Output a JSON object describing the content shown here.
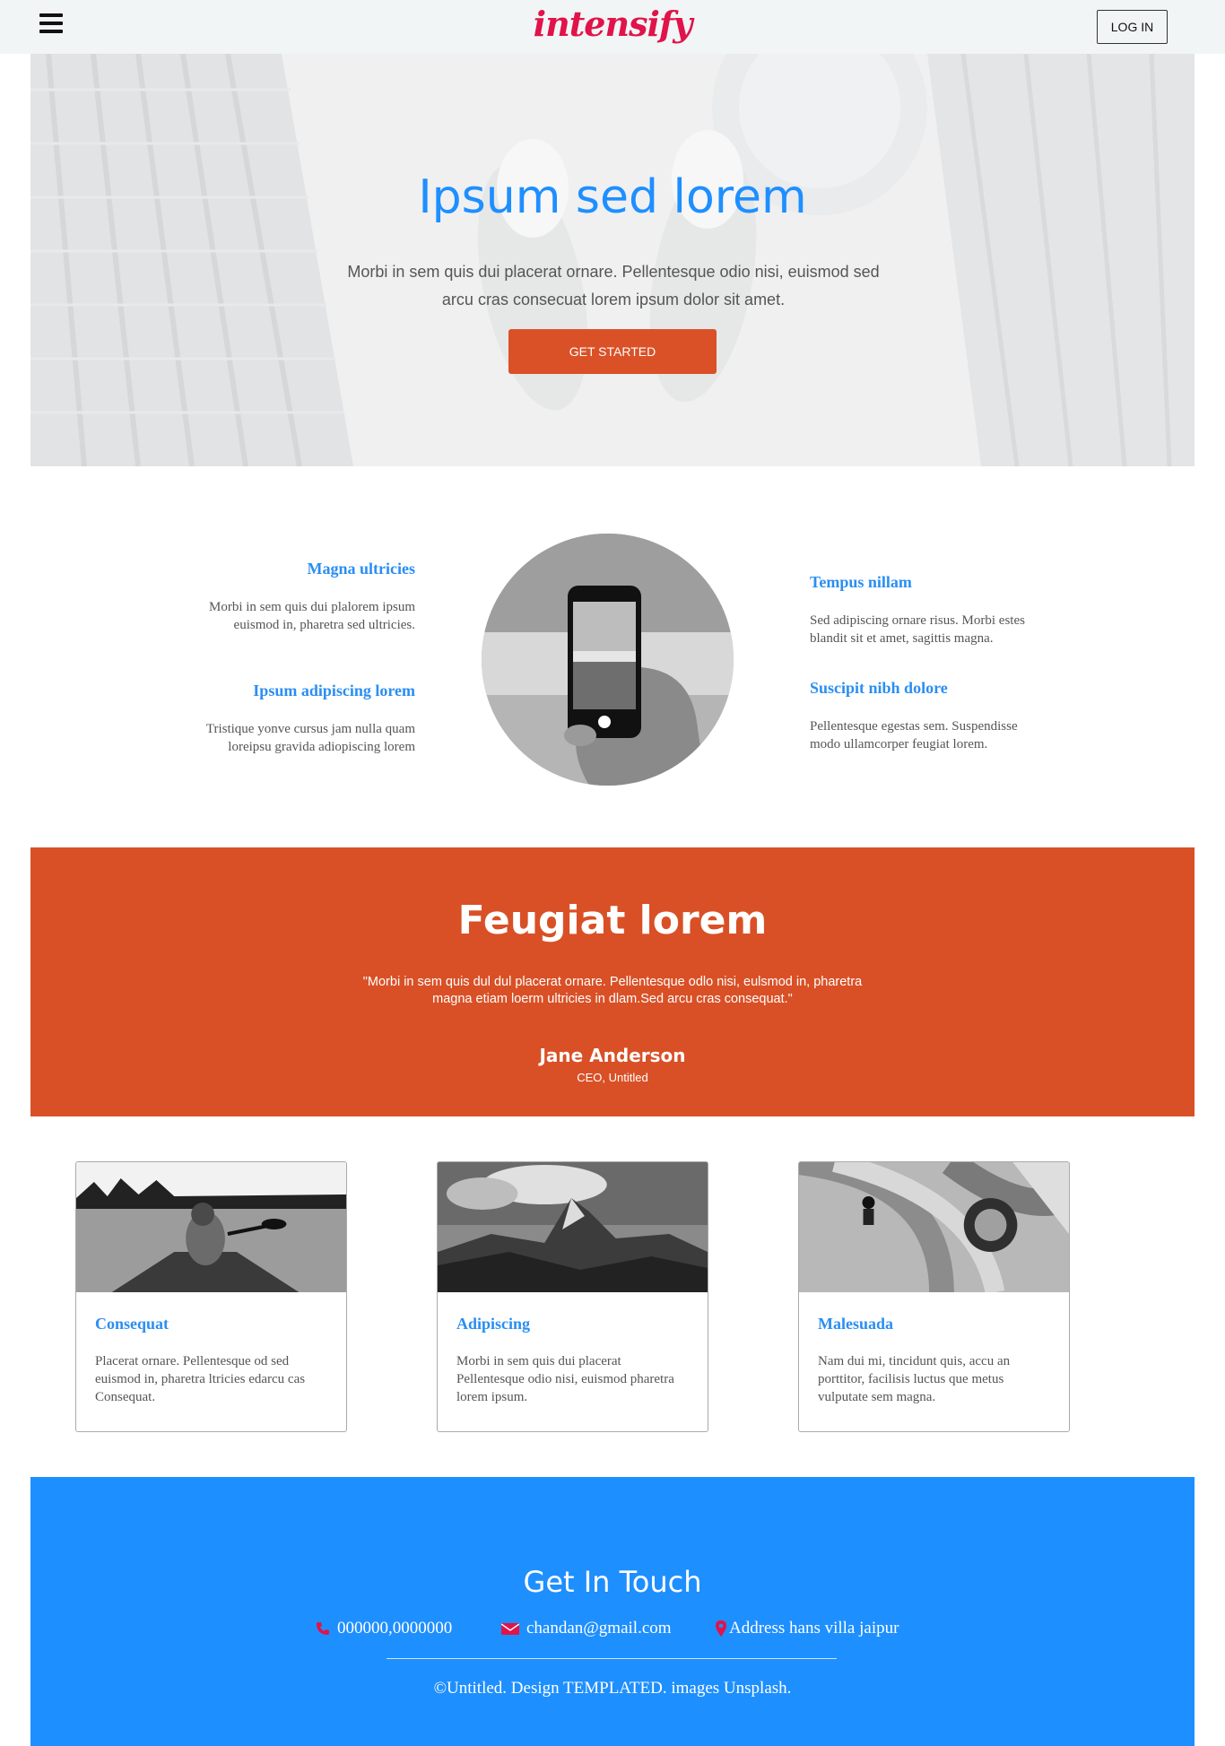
{
  "header": {
    "logo": "intensify",
    "login_label": "LOG IN"
  },
  "hero": {
    "title": "Ipsum sed lorem",
    "text": "Morbi in sem quis dui placerat ornare. Pellentesque odio nisi, euismod sed arcu cras consecuat lorem ipsum dolor sit amet.",
    "cta_label": "GET STARTED"
  },
  "features": {
    "left": [
      {
        "title": "Magna ultricies",
        "text": "Morbi in sem quis dui plalorem ipsum euismod in, pharetra sed ultricies."
      },
      {
        "title": "Ipsum adipiscing lorem",
        "text": "Tristique yonve cursus jam nulla quam loreipsu gravida adiopiscing lorem"
      }
    ],
    "right": [
      {
        "title": "Tempus nillam",
        "text": "Sed adipiscing ornare risus. Morbi estes blandit sit et amet, sagittis magna."
      },
      {
        "title": "Suscipit nibh dolore",
        "text": "Pellentesque egestas sem. Suspendisse modo ullamcorper feugiat lorem."
      }
    ]
  },
  "testimonial": {
    "title": "Feugiat lorem",
    "quote": "\"Morbi in sem quis dul dul placerat ornare. Pellentesque odlo nisi, eulsmod in, pharetra magna etiam loerm ultricies in dlam.Sed arcu cras consequat.\"",
    "name": "Jane Anderson",
    "role": "CEO, Untitled"
  },
  "cards": [
    {
      "title": "Consequat",
      "text": "Placerat ornare. Pellentesque od sed euismod in, pharetra ltricies edarcu cas Consequat."
    },
    {
      "title": "Adipiscing",
      "text": "Morbi in sem quis dui placerat Pellentesque odio nisi, euismod pharetra lorem ipsum."
    },
    {
      "title": "Malesuada",
      "text": "Nam dui mi, tincidunt quis, accu an porttitor, facilisis luctus que metus vulputate sem magna."
    }
  ],
  "footer": {
    "title": "Get In Touch",
    "phone": "000000,0000000",
    "email": "chandan@gmail.com",
    "address": "Address hans villa jaipur",
    "copyright": "©Untitled. Design TEMPLATED. images Unsplash."
  },
  "colors": {
    "brand": "#e0134a",
    "primary": "#1e8fff",
    "accent": "#d95026"
  }
}
